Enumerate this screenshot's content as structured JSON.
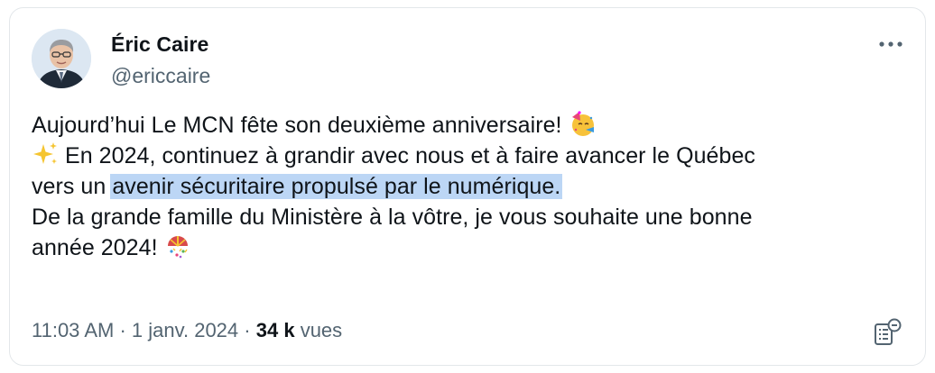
{
  "author": {
    "name": "Éric Caire",
    "handle": "@ericcaire",
    "avatar_icon": "profile-photo"
  },
  "tweet": {
    "line1": "Aujourd’hui Le MCN fête son deuxième anniversaire!",
    "line1_emoji": "party-face-icon",
    "line2_emoji": "sparkles-icon",
    "line2": "En 2024, continuez à grandir avec nous et à faire avancer le Québec",
    "line3_prefix": "vers un",
    "line3_highlight": "avenir sécuritaire propulsé par le numérique.",
    "line4": "De la grande famille du Ministère à la vôtre, je vous souhaite une bonne",
    "line5": "année 2024!",
    "line5_emoji": "confetti-ball-icon"
  },
  "meta": {
    "time": "11:03 AM",
    "sep1": "·",
    "date": "1 janv. 2024",
    "sep2": "·",
    "views_count": "34 k",
    "views_label": "vues"
  },
  "icons": {
    "more": "more-horizontal-icon",
    "analytics": "analytics-icon"
  },
  "colors": {
    "text": "#0f1419",
    "secondary": "#536471",
    "highlight": "#bcd6f5",
    "border": "#e3e7ea"
  }
}
